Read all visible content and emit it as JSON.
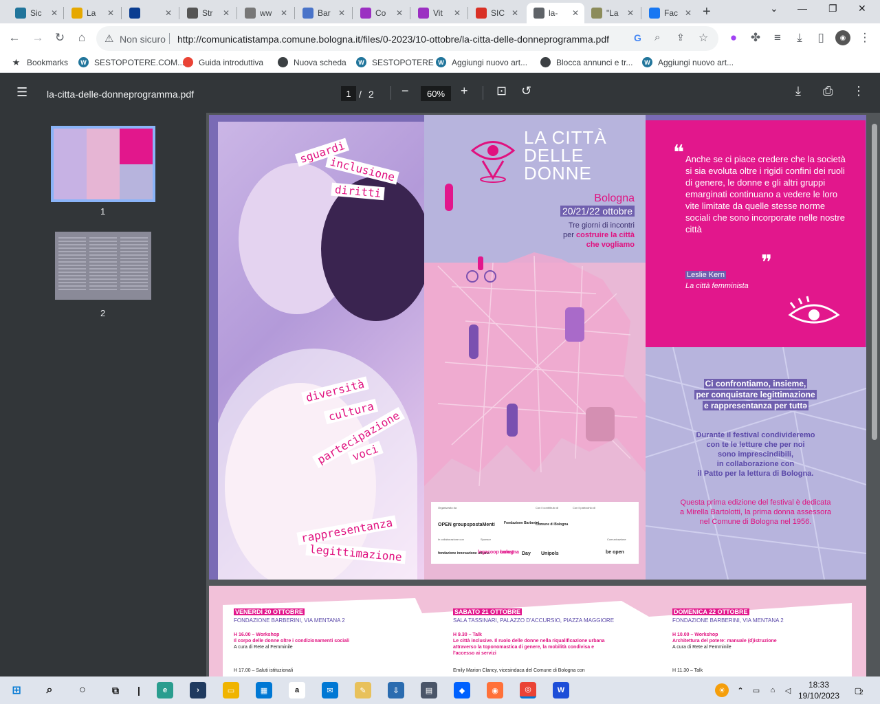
{
  "tabs": [
    {
      "label": "Sic",
      "icon": "wordpress-icon",
      "color": "#21759b"
    },
    {
      "label": "La",
      "icon": "repubblica-icon",
      "color": "#e6a800"
    },
    {
      "label": "",
      "icon": "rai-icon",
      "color": "#0a3d91"
    },
    {
      "label": "Str",
      "icon": "site-icon",
      "color": "#555555"
    },
    {
      "label": "ww",
      "icon": "site-icon",
      "color": "#777777"
    },
    {
      "label": "Bar",
      "icon": "site-icon",
      "color": "#4a74c9"
    },
    {
      "label": "Co",
      "icon": "comunicati-icon",
      "color": "#9b2fc2"
    },
    {
      "label": "Vit",
      "icon": "comunicati-icon",
      "color": "#9b2fc2"
    },
    {
      "label": "SIC",
      "icon": "gmail-icon",
      "color": "#d93025"
    },
    {
      "label": "la-",
      "icon": "globe-icon",
      "color": "#5f6368"
    },
    {
      "label": "\"La",
      "icon": "doc-icon",
      "color": "#8c8c5a"
    },
    {
      "label": "Fac",
      "icon": "facebook-icon",
      "color": "#1877f2"
    }
  ],
  "omnibox": {
    "security": "Non sicuro",
    "url": "http://comunicatistampa.comune.bologna.it/files/0-2023/10-ottobre/la-citta-delle-donneprogramma.pdf"
  },
  "bookmarks": [
    {
      "label": "Bookmarks",
      "icon": "star-icon",
      "color": "#3c4043"
    },
    {
      "label": "SESTOPOTERE.COM...",
      "icon": "wordpress-icon",
      "color": "#21759b"
    },
    {
      "label": "Guida introduttiva",
      "icon": "chrome-icon",
      "color": "#ea4335"
    },
    {
      "label": "Nuova scheda",
      "icon": "globe-icon",
      "color": "#3c4043"
    },
    {
      "label": "SESTOPOTERE",
      "icon": "wordpress-icon",
      "color": "#21759b"
    },
    {
      "label": "Aggiungi nuovo art...",
      "icon": "wordpress-icon",
      "color": "#21759b"
    },
    {
      "label": "Blocca annunci e tr...",
      "icon": "globe-icon",
      "color": "#3c4043"
    },
    {
      "label": "Aggiungi nuovo art...",
      "icon": "wordpress-icon",
      "color": "#21759b"
    }
  ],
  "pdf": {
    "filename": "la-citta-delle-donneprogramma.pdf",
    "page": "1",
    "sep": "/",
    "total": "2",
    "zoom": "60%"
  },
  "sidebar": {
    "thumb1": "1",
    "thumb2": "2"
  },
  "page1": {
    "words_top": [
      "sguardi",
      "inclusione",
      "diritti"
    ],
    "words_mid": [
      "diversità",
      "cultura",
      "partecipazione",
      "voci"
    ],
    "words_bot": [
      "rappresentanza",
      "legittimazione"
    ],
    "title_lines": [
      "LA CITTÀ",
      "DELLE",
      "DONNE"
    ],
    "city": "Bologna",
    "dates": "20/21/22 ottobre",
    "tagline_a": "Tre giorni di incontri",
    "tagline_b": "per ",
    "tagline_c": "costruire la città",
    "tagline_d": "che vogliamo",
    "quote": "Anche se ci piace credere che la società si sia evoluta oltre i rigidi confini dei ruoli di genere, le donne e gli altri gruppi emarginati continuano a vedere le loro vite limitate da quelle stesse norme sociali che sono incorporate nelle nostre città",
    "author": "Leslie Kern",
    "book": "La città femminista",
    "claim": [
      "Ci confrontiamo, insieme,",
      "per conquistare legittimazione",
      "e rappresentanza per tuttə"
    ],
    "festival": [
      "Durante il festival condivideremo",
      "con te le letture che per noi",
      "sono imprescindibili,",
      "in collaborazione con",
      "il Patto per la lettura di Bologna."
    ],
    "dedica": [
      "Questa prima edizione del festival è dedicata",
      "a Mirella Bartolotti, la prima donna assessora",
      "nel Comune di Bologna nel 1956."
    ],
    "sponsor_heads": [
      "Organizzato da",
      "Con il contributo di",
      "Con il patrocinio di",
      "In collaborazione con",
      "Sponsor",
      "Comunicazione"
    ],
    "sponsors": [
      "OPEN group",
      "spostaMenti",
      "Fondazione Barberini",
      "Comune di Bologna",
      "fondazione innovazione urbana",
      "legacoop bologna",
      "camst",
      "Day",
      "Unipols",
      "be open"
    ]
  },
  "page2": {
    "days": [
      {
        "head": "VENERDÌ 20 OTTOBRE",
        "place": "FONDAZIONE BARBERINI, VIA MENTANA 2",
        "time": "H 16.00 – Workshop",
        "title": "Il corpo delle donne oltre i condizionamenti sociali",
        "sub": "A cura di Rete al Femminile",
        "time2": "H 17.00 – Saluti istituzionali"
      },
      {
        "head": "SABATO 21 OTTOBRE",
        "place": "SALA TASSINARI, PALAZZO D'ACCURSIO, PIAZZA MAGGIORE",
        "time": "H 9.30 – Talk",
        "title": "Le città inclusive. Il ruolo delle donne nella riqualificazione urbana attraverso la toponomastica di genere, la mobilità condivisa e l'accesso ai servizi",
        "sub": "",
        "time2": "Emily Marion Clancy, vicesindaca del Comune di Bologna con"
      },
      {
        "head": "DOMENICA 22 OTTOBRE",
        "place": "FONDAZIONE BARBERINI, VIA MENTANA 2",
        "time": "H 10.00 – Workshop",
        "title": "Architettura del potere: manuale (d)istruzione",
        "sub": "A cura di Rete al Femminile",
        "time2": "H 11.30 – Talk"
      }
    ]
  },
  "taskbar": {
    "time": "18:33",
    "date": "19/10/2023",
    "notif": "2"
  },
  "colors": {
    "pink": "#e2178c",
    "purple": "#6f5fae",
    "lavender": "#b7b4dd"
  }
}
